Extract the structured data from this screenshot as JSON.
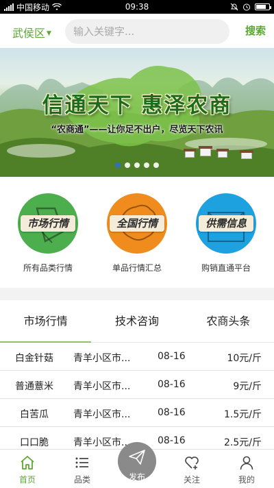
{
  "status_bar": {
    "carrier": "中国移动",
    "time": "09:38",
    "battery_level": 0.75
  },
  "header": {
    "region": "武侯区",
    "search_placeholder": "输入关键字...",
    "search_button": "搜索"
  },
  "banner": {
    "headline": "信通天下 惠泽农商",
    "tagline": "“农商通”——让你足不出户，尽览天下农讯",
    "slide_count": 5,
    "active_slide": 1
  },
  "categories": [
    {
      "label": "市场行情",
      "subtitle": "所有品类行情",
      "color": "#4cae4c",
      "icon": "thumbs-up-icon"
    },
    {
      "label": "全国行情",
      "subtitle": "单品行情汇总",
      "color": "#f08c1e",
      "icon": "china-map-icon"
    },
    {
      "label": "供需信息",
      "subtitle": "购销直通平台",
      "color": "#1da1df",
      "icon": "envelope-icon"
    }
  ],
  "tabs": [
    {
      "label": "市场行情",
      "active": true
    },
    {
      "label": "技术咨询",
      "active": false
    },
    {
      "label": "农商头条",
      "active": false
    }
  ],
  "market_rows": [
    {
      "name": "白金针菇",
      "market": "青羊小区市...",
      "date": "08-16",
      "price": "10元/斤"
    },
    {
      "name": "普通薏米",
      "market": "青羊小区市...",
      "date": "08-16",
      "price": "9元/斤"
    },
    {
      "name": "白苦瓜",
      "market": "青羊小区市...",
      "date": "08-16",
      "price": "1.5元/斤"
    },
    {
      "name": "口口脆",
      "market": "青羊小区市...",
      "date": "08-16",
      "price": "2.5元/斤"
    }
  ],
  "bottom_nav": [
    {
      "label": "首页",
      "icon": "home-icon",
      "active": true
    },
    {
      "label": "品类",
      "icon": "list-icon",
      "active": false
    },
    {
      "label": "发布",
      "icon": "paper-plane-icon",
      "active": false
    },
    {
      "label": "关注",
      "icon": "heart-plus-icon",
      "active": false
    },
    {
      "label": "我的",
      "icon": "user-icon",
      "active": false
    }
  ],
  "colors": {
    "accent_green": "#5aa832",
    "tab_underline": "#8dc16b",
    "dot_active": "#2f6fc9"
  }
}
